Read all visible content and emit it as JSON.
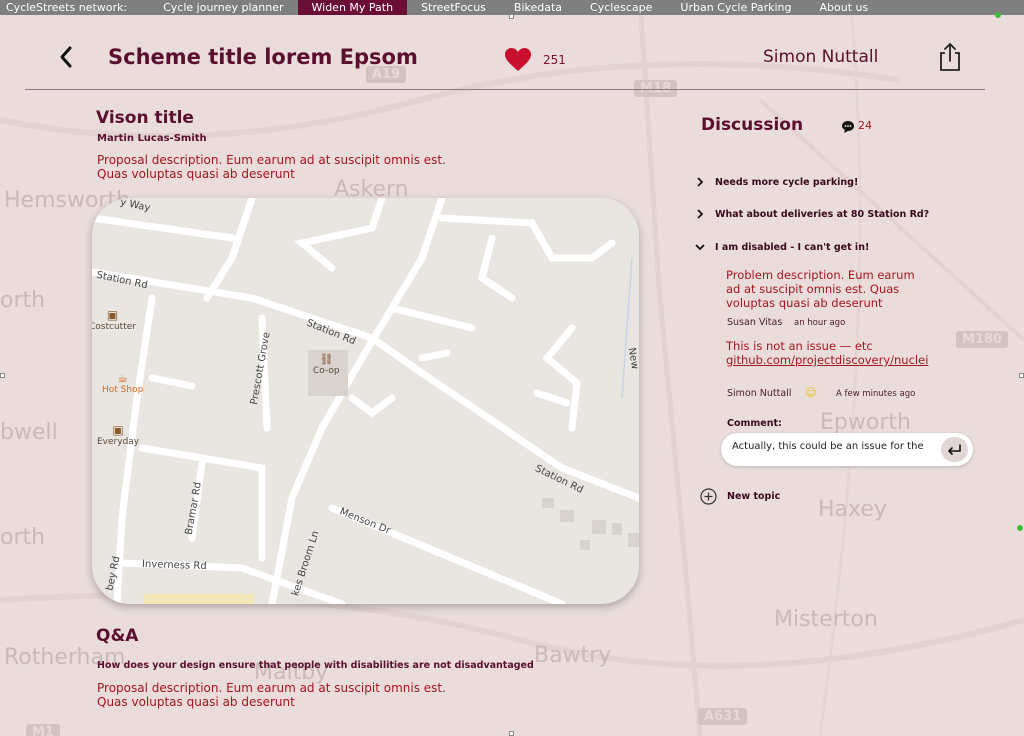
{
  "nav": {
    "brand": "CycleStreets network:",
    "items": [
      {
        "label": "Cycle journey planner",
        "active": false
      },
      {
        "label": "Widen My Path",
        "active": true
      },
      {
        "label": "StreetFocus",
        "active": false
      },
      {
        "label": "Bikedata",
        "active": false
      },
      {
        "label": "Cyclescape",
        "active": false
      },
      {
        "label": "Urban Cycle Parking",
        "active": false
      },
      {
        "label": "About us",
        "active": false
      }
    ]
  },
  "header": {
    "title": "Scheme title lorem Epsom",
    "likes": "251",
    "user": "Simon Nuttall",
    "back_icon": "chevron-left-icon",
    "like_icon": "heart-icon",
    "share_icon": "share-icon"
  },
  "vision": {
    "title": "Vison title",
    "author": "Martin Lucas-Smith",
    "description": "Proposal description. Eum earum ad at suscipit omnis est. Quas voluptas quasi ab deserunt"
  },
  "map": {
    "roads": [
      "y Way",
      "Station Rd",
      "Station Rd",
      "Station Rd",
      "Prescott Grove",
      "Bramar Rd",
      "Inverness Rd",
      "Menson Dr",
      "kes Broom Ln",
      "bey Rd",
      "New"
    ],
    "pois": [
      {
        "label": "Costcutter",
        "icon": "basket-icon"
      },
      {
        "label": "Hot Shop",
        "icon": "cup-icon"
      },
      {
        "label": "Everyday",
        "icon": "basket-icon"
      },
      {
        "label": "Co-op",
        "icon": "cart-icon"
      }
    ]
  },
  "background_map": {
    "places": [
      "Hemsworth",
      "Askern",
      "orth",
      "bwell",
      "orth",
      "Rotherham",
      "Bawtry",
      "Epworth",
      "Haxey",
      "Misterton",
      "Maltby"
    ],
    "roads": [
      "A19",
      "M18",
      "M180",
      "A631",
      "M1"
    ]
  },
  "qa": {
    "title": "Q&A",
    "question": "How does your design ensure that people with disabilities are not disadvantaged",
    "description": "Proposal description. Eum earum ad at suscipit omnis est. Quas voluptas quasi ab deserunt"
  },
  "discussion": {
    "title": "Discussion",
    "count": "24",
    "topics": [
      {
        "label": "Needs more cycle parking!",
        "expanded": false
      },
      {
        "label": "What about deliveries at 80 Station Rd?",
        "expanded": false
      },
      {
        "label": "I am disabled - I can't get in!",
        "expanded": true
      }
    ],
    "comments": [
      {
        "text": "Problem description. Eum earum ad at suscipit omnis est. Quas voluptas quasi ab deserunt",
        "author": "Susan Vitas",
        "time": "an hour ago"
      },
      {
        "text": "This is not an issue — etc",
        "link": "github.com/projectdiscovery/nuclei",
        "author": "Simon Nuttall",
        "time": "A few minutes ago"
      }
    ],
    "comment_label": "Comment:",
    "comment_value": "Actually, this could be an issue for the",
    "new_topic": "New topic"
  },
  "colors": {
    "brand": "#6b0e35",
    "accent_text": "#a3161f",
    "heart": "#c8102e",
    "background": "#e9dcda"
  }
}
